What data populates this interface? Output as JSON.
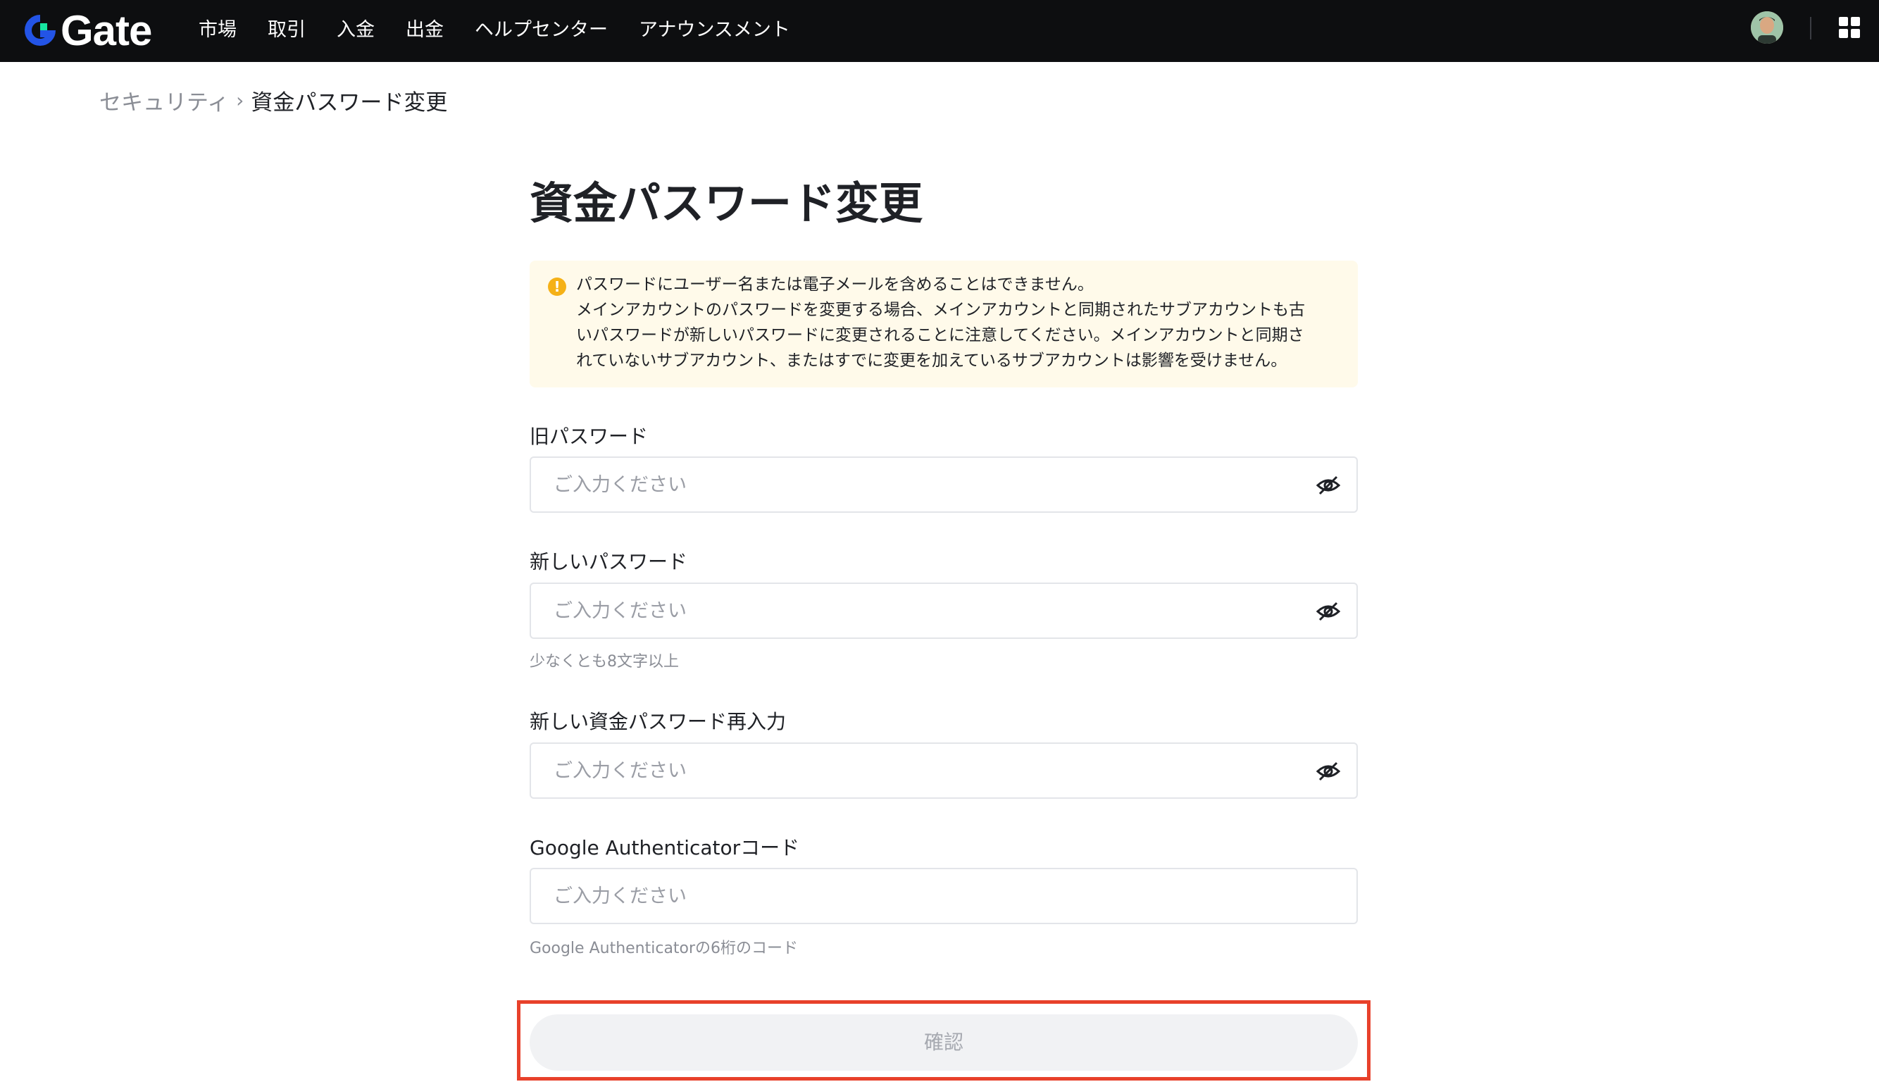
{
  "header": {
    "logo_text": "Gate",
    "nav": [
      "市場",
      "取引",
      "入金",
      "出金",
      "ヘルプセンター",
      "アナウンスメント"
    ],
    "apps_icon": "grid-apps-icon",
    "avatar_icon": "user-avatar"
  },
  "breadcrumb": {
    "parent": "セキュリティ",
    "separator": "›",
    "current": "資金パスワード変更"
  },
  "page": {
    "title": "資金パスワード変更",
    "notice": {
      "icon": "warning-icon",
      "color": "#f5b117",
      "lines": [
        "パスワードにユーザー名または電子メールを含めることはできません。",
        "メインアカウントのパスワードを変更する場合、メインアカウントと同期されたサブアカウントも古",
        "いパスワードが新しいパスワードに変更されることに注意してください。メインアカウントと同期さ",
        "れていないサブアカウント、またはすでに変更を加えているサブアカウントは影響を受けません。"
      ]
    },
    "fields": [
      {
        "label": "旧パスワード",
        "placeholder": "ご入力ください",
        "value": "",
        "has_eye": true,
        "hint": ""
      },
      {
        "label": "新しいパスワード",
        "placeholder": "ご入力ください",
        "value": "",
        "has_eye": true,
        "hint": "少なくとも8文字以上"
      },
      {
        "label": "新しい資金パスワード再入力",
        "placeholder": "ご入力ください",
        "value": "",
        "has_eye": true,
        "hint": ""
      },
      {
        "label": "Google Authenticatorコード",
        "placeholder": "ご入力ください",
        "value": "",
        "has_eye": false,
        "hint": "Google Authenticatorの6桁のコード"
      }
    ],
    "confirm_label": "確認",
    "highlight_color": "#e8412b"
  },
  "colors": {
    "topbar": "#0d0e10",
    "brand_blue": "#2354e6",
    "brand_green": "#17e6a1"
  }
}
